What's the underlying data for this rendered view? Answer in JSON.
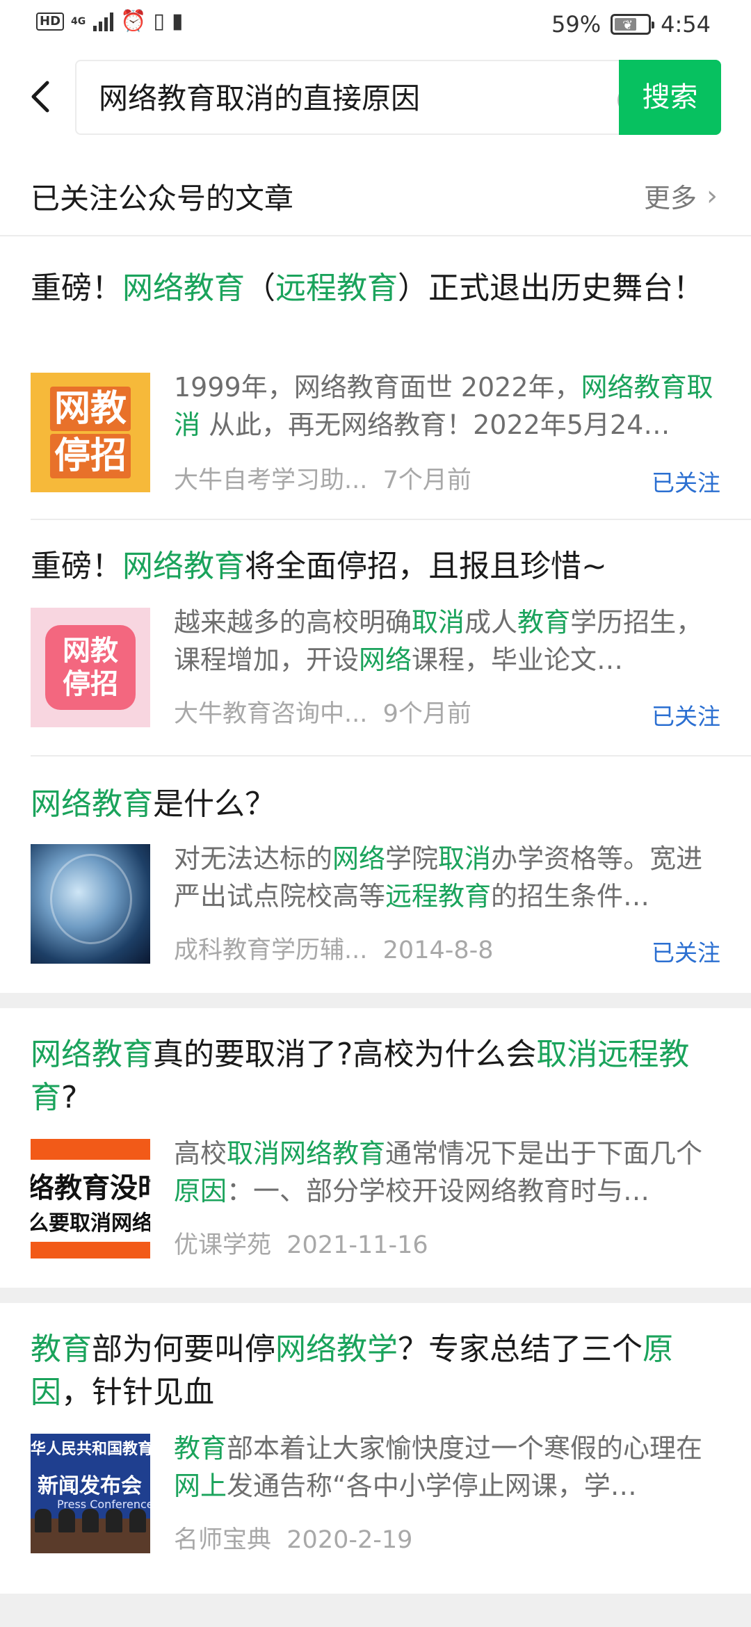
{
  "status_bar": {
    "hd": "HD",
    "network": "4G",
    "battery_percent": "59%",
    "time": "4:54"
  },
  "search": {
    "query": "网络教育取消的直接原因",
    "button_label": "搜索"
  },
  "section": {
    "title": "已关注公众号的文章",
    "more_label": "更多"
  },
  "articles": [
    {
      "title_parts": [
        {
          "text": "重磅！",
          "hl": false
        },
        {
          "text": "网络教育",
          "hl": true
        },
        {
          "text": "（",
          "hl": false
        },
        {
          "text": "远程教育",
          "hl": true
        },
        {
          "text": "）正式退出历史舞台！",
          "hl": false
        }
      ],
      "thumb_text": [
        "网教",
        "停招"
      ],
      "snippet_parts": [
        {
          "text": "1999年，网络教育面世 2022年，",
          "hl": false
        },
        {
          "text": "网络教育取消",
          "hl": true
        },
        {
          "text": " 从此，再无网络教育！2022年5月24…",
          "hl": false
        }
      ],
      "source": "大牛自考学习助...",
      "date": "7个月前",
      "follow": "已关注"
    },
    {
      "title_parts": [
        {
          "text": "重磅！",
          "hl": false
        },
        {
          "text": "网络教育",
          "hl": true
        },
        {
          "text": "将全面停招，且报且珍惜~",
          "hl": false
        }
      ],
      "thumb_text": [
        "网教",
        "停招"
      ],
      "snippet_parts": [
        {
          "text": "越来越多的高校明确",
          "hl": false
        },
        {
          "text": "取消",
          "hl": true
        },
        {
          "text": "成人",
          "hl": false
        },
        {
          "text": "教育",
          "hl": true
        },
        {
          "text": "学历招生，课程增加，开设",
          "hl": false
        },
        {
          "text": "网络",
          "hl": true
        },
        {
          "text": "课程，毕业论文…",
          "hl": false
        }
      ],
      "source": "大牛教育咨询中...",
      "date": "9个月前",
      "follow": "已关注"
    },
    {
      "title_parts": [
        {
          "text": "网络教育",
          "hl": true
        },
        {
          "text": "是什么？",
          "hl": false
        }
      ],
      "snippet_parts": [
        {
          "text": "对无法达标的",
          "hl": false
        },
        {
          "text": "网络",
          "hl": true
        },
        {
          "text": "学院",
          "hl": false
        },
        {
          "text": "取消",
          "hl": true
        },
        {
          "text": "办学资格等。宽进严出试点院校高等",
          "hl": false
        },
        {
          "text": "远程教育",
          "hl": true
        },
        {
          "text": "的招生条件…",
          "hl": false
        }
      ],
      "source": "成科教育学历辅...",
      "date": "2014-8-8",
      "follow": "已关注"
    },
    {
      "title_parts": [
        {
          "text": "网络教育",
          "hl": true
        },
        {
          "text": "真的要取消了?高校为什么会",
          "hl": false
        },
        {
          "text": "取消远程教育",
          "hl": true
        },
        {
          "text": "?",
          "hl": false
        }
      ],
      "thumb_text": [
        "络教育没时",
        "么要取消网络"
      ],
      "snippet_parts": [
        {
          "text": "高校",
          "hl": false
        },
        {
          "text": "取消网络教育",
          "hl": true
        },
        {
          "text": "通常情况下是出于下面几个",
          "hl": false
        },
        {
          "text": "原因",
          "hl": true
        },
        {
          "text": "：一、部分学校开设网络教育时与…",
          "hl": false
        }
      ],
      "source": "优课学苑",
      "date": "2021-11-16"
    },
    {
      "title_parts": [
        {
          "text": "教育",
          "hl": true
        },
        {
          "text": "部为何要叫停",
          "hl": false
        },
        {
          "text": "网络教学",
          "hl": true
        },
        {
          "text": "？专家总结了三个",
          "hl": false
        },
        {
          "text": "原因",
          "hl": true
        },
        {
          "text": "，针针见血",
          "hl": false
        }
      ],
      "thumb_text": [
        "华人民共和国教育",
        "新闻发布会",
        "Press Conference"
      ],
      "snippet_parts": [
        {
          "text": "教育",
          "hl": true
        },
        {
          "text": "部本着让大家愉快度过一个寒假的心理在",
          "hl": false
        },
        {
          "text": "网上",
          "hl": true
        },
        {
          "text": "发通告称“各中小学停止网课，学…",
          "hl": false
        }
      ],
      "source": "名师宝典",
      "date": "2020-2-19"
    }
  ],
  "colors": {
    "accent_green": "#07c160",
    "highlight_green": "#1aa35b",
    "follow_blue": "#2b6fd1"
  }
}
